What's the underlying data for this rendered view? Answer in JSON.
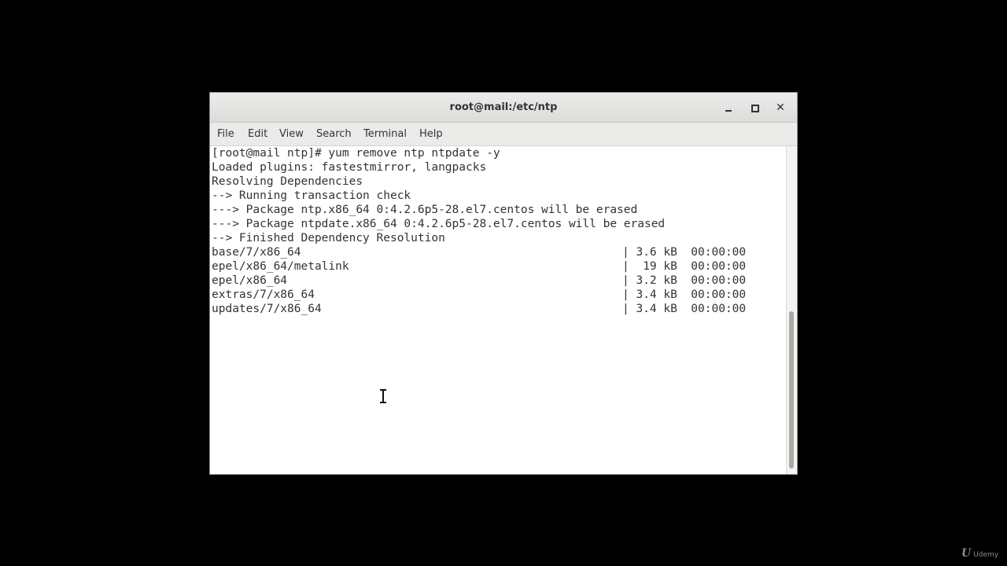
{
  "window": {
    "title": "root@mail:/etc/ntp",
    "controls": {
      "minimize_icon": "minimize-icon",
      "maximize_icon": "maximize-icon",
      "close_icon": "close-icon",
      "close_glyph": "✕"
    }
  },
  "menu": [
    {
      "label": "File"
    },
    {
      "label": "Edit"
    },
    {
      "label": "View"
    },
    {
      "label": "Search"
    },
    {
      "label": "Terminal"
    },
    {
      "label": "Help"
    }
  ],
  "terminal": {
    "lines": [
      "[root@mail ntp]# yum remove ntp ntpdate -y",
      "Loaded plugins: fastestmirror, langpacks",
      "Resolving Dependencies",
      "--> Running transaction check",
      "---> Package ntp.x86_64 0:4.2.6p5-28.el7.centos will be erased",
      "---> Package ntpdate.x86_64 0:4.2.6p5-28.el7.centos will be erased",
      "--> Finished Dependency Resolution"
    ],
    "downloads": [
      {
        "repo": "base/7/x86_64",
        "info": "| 3.6 kB  00:00:00"
      },
      {
        "repo": "epel/x86_64/metalink",
        "info": "|  19 kB  00:00:00"
      },
      {
        "repo": "epel/x86_64",
        "info": "| 3.2 kB  00:00:00"
      },
      {
        "repo": "extras/7/x86_64",
        "info": "| 3.4 kB  00:00:00"
      },
      {
        "repo": "updates/7/x86_64",
        "info": "| 3.4 kB  00:00:00"
      }
    ]
  },
  "watermark": {
    "logo": "U",
    "text": "Udemy"
  },
  "colors": {
    "terminal_text": "#2e3436",
    "background": "#000000",
    "terminal_bg": "#ffffff"
  }
}
